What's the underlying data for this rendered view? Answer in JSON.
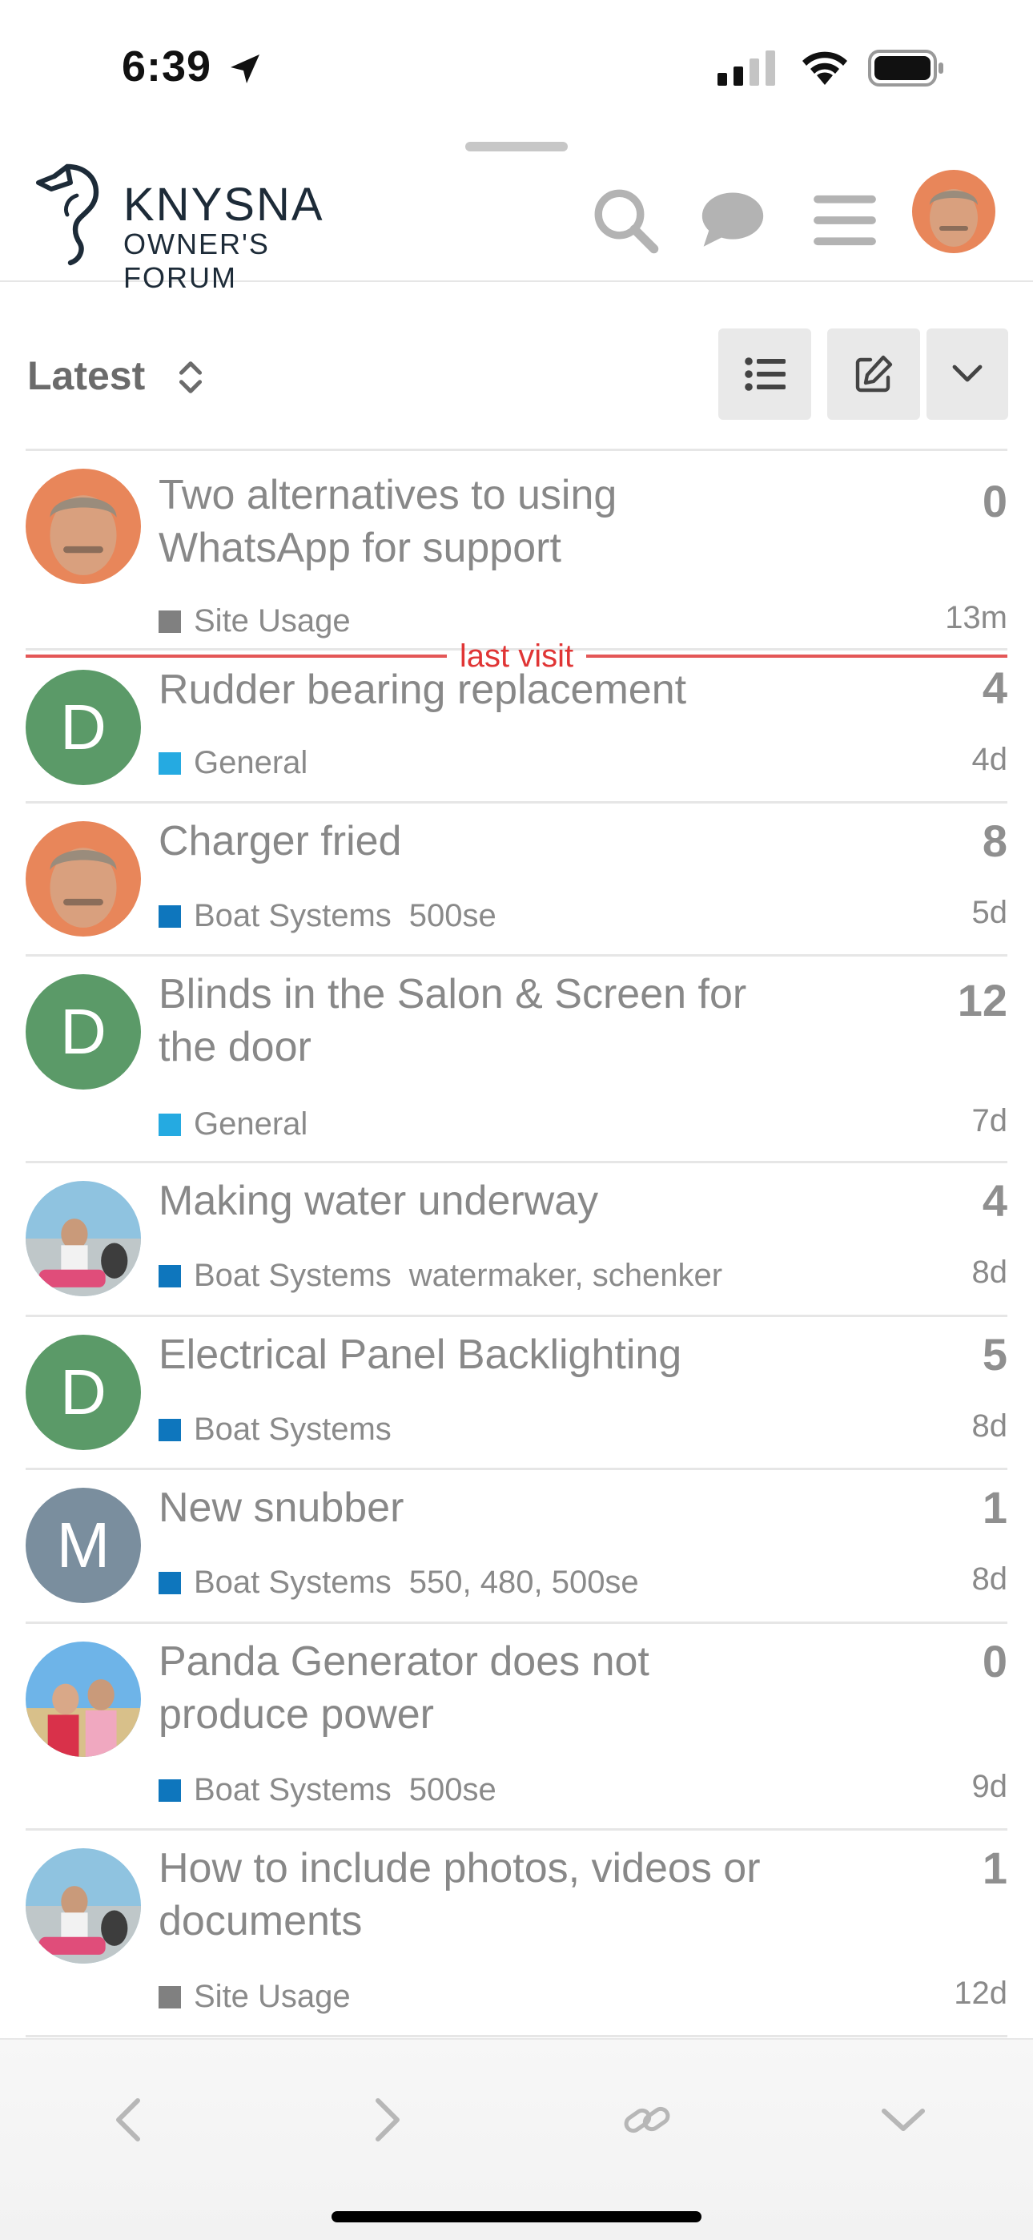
{
  "status_bar": {
    "time": "6:39"
  },
  "header": {
    "logo_title": "KNYSNA",
    "logo_subtitle": "OWNER'S FORUM",
    "icons": [
      "search-icon",
      "chat-icon",
      "hamburger-menu-icon",
      "user-avatar"
    ]
  },
  "nav": {
    "filter_label": "Latest",
    "buttons": [
      "list-view-icon",
      "compose-icon",
      "chevron-down-icon"
    ]
  },
  "colors": {
    "site_usage": "#808080",
    "general": "#25aae1",
    "boat_systems": "#0e76bd",
    "last_visit": "#e03535",
    "avatar_d": "#5b9a68",
    "avatar_m": "#7a8e9e"
  },
  "last_visit_label": "last visit",
  "topics": [
    {
      "title_lines": [
        "Two alternatives to using",
        "WhatsApp for support"
      ],
      "category": "Site Usage",
      "tags": "",
      "replies": "0",
      "age": "13m"
    },
    {
      "title_lines": [
        "Rudder bearing replacement"
      ],
      "category": "General",
      "tags": "",
      "replies": "4",
      "age": "4d"
    },
    {
      "title_lines": [
        "Charger fried"
      ],
      "category": "Boat Systems",
      "tags": "500se",
      "replies": "8",
      "age": "5d"
    },
    {
      "title_lines": [
        "Blinds in the Salon & Screen for",
        "the door"
      ],
      "category": "General",
      "tags": "",
      "replies": "12",
      "age": "7d"
    },
    {
      "title_lines": [
        "Making water underway"
      ],
      "category": "Boat Systems",
      "tags": "watermaker, schenker",
      "replies": "4",
      "age": "8d"
    },
    {
      "title_lines": [
        "Electrical Panel Backlighting"
      ],
      "category": "Boat Systems",
      "tags": "",
      "replies": "5",
      "age": "8d"
    },
    {
      "title_lines": [
        "New snubber"
      ],
      "category": "Boat Systems",
      "tags": "550, 480, 500se",
      "replies": "1",
      "age": "8d"
    },
    {
      "title_lines": [
        "Panda Generator does not",
        "produce power"
      ],
      "category": "Boat Systems",
      "tags": "500se",
      "replies": "0",
      "age": "9d"
    },
    {
      "title_lines": [
        "How to include photos, videos or",
        "documents"
      ],
      "category": "Site Usage",
      "tags": "",
      "replies": "1",
      "age": "12d"
    }
  ],
  "avatar_letters": {
    "d": "D",
    "m": "M"
  },
  "toolbar": {
    "icons": [
      "back-arrow-icon",
      "forward-arrow-icon",
      "link-icon",
      "chevron-down-icon"
    ]
  }
}
